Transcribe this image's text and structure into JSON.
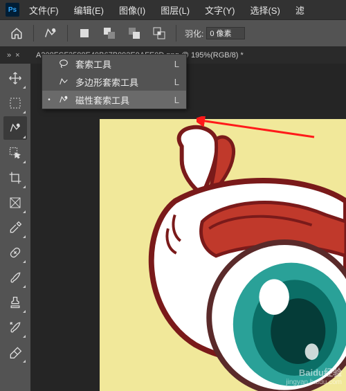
{
  "app": {
    "logo": "Ps"
  },
  "menu": {
    "file": "文件(F)",
    "edit": "编辑(E)",
    "image": "图像(I)",
    "layer": "图层(L)",
    "type": "文字(Y)",
    "select": "选择(S)",
    "filter_partial": "滤"
  },
  "options": {
    "feather_label": "羽化:",
    "feather_value": "0 像素"
  },
  "tabrow": {
    "chevrons": "»",
    "close": "×",
    "doc_title": "A308FCF3588E49B67B892E9AFE0D.png @ 195%(RGB/8) *"
  },
  "flyout": {
    "items": [
      {
        "selected": false,
        "icon": "lasso",
        "label": "套索工具",
        "key": "L"
      },
      {
        "selected": false,
        "icon": "poly",
        "label": "多边形套索工具",
        "key": "L"
      },
      {
        "selected": true,
        "icon": "magnetic",
        "label": "磁性套索工具",
        "key": "L"
      }
    ]
  },
  "watermark": {
    "brand": "Baidu经验",
    "url": "jingyan.baidu.com"
  }
}
